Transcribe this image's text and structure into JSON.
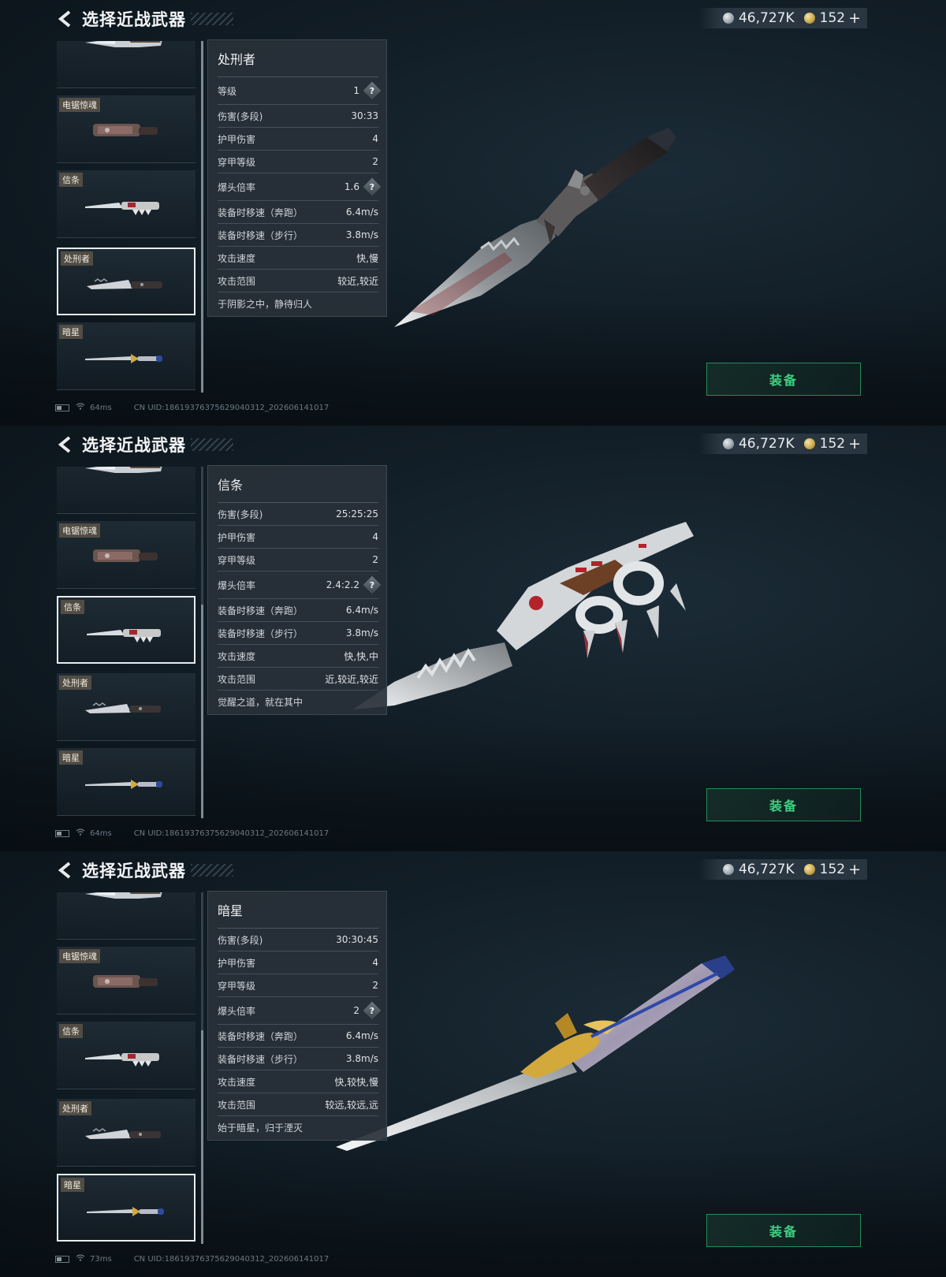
{
  "screens": [
    {
      "header": {
        "title": "选择近战武器"
      },
      "currency": {
        "silver": "46,727K",
        "gold": "152",
        "plus": "+"
      },
      "list": {
        "cards": [
          {
            "label": ""
          },
          {
            "label": "电锯惊魂"
          },
          {
            "label": "信条"
          },
          {
            "label": "处刑者"
          },
          {
            "label": "暗星"
          }
        ],
        "selected_index": 3
      },
      "panel": {
        "title": "处刑者",
        "rows": [
          {
            "label": "等级",
            "value": "1",
            "help": true
          },
          {
            "label": "伤害(多段)",
            "value": "30:33",
            "help": false
          },
          {
            "label": "护甲伤害",
            "value": "4",
            "help": false
          },
          {
            "label": "穿甲等级",
            "value": "2",
            "help": false
          },
          {
            "label": "爆头倍率",
            "value": "1.6",
            "help": true
          },
          {
            "label": "装备时移速（奔跑）",
            "value": "6.4m/s",
            "help": false
          },
          {
            "label": "装备时移速（步行）",
            "value": "3.8m/s",
            "help": false
          },
          {
            "label": "攻击速度",
            "value": "快,慢",
            "help": false
          },
          {
            "label": "攻击范围",
            "value": "较近,较近",
            "help": false
          }
        ],
        "description": "于阴影之中，静待归人"
      },
      "equip_label": "装备",
      "status": {
        "ping": "64ms",
        "uid": "CN UID:1861937637562904031​2_202606141017"
      }
    },
    {
      "header": {
        "title": "选择近战武器"
      },
      "currency": {
        "silver": "46,727K",
        "gold": "152",
        "plus": "+"
      },
      "list": {
        "cards": [
          {
            "label": ""
          },
          {
            "label": "电锯惊魂"
          },
          {
            "label": "信条"
          },
          {
            "label": "处刑者"
          },
          {
            "label": "暗星"
          }
        ],
        "selected_index": 2
      },
      "panel": {
        "title": "信条",
        "rows": [
          {
            "label": "伤害(多段)",
            "value": "25:25:25",
            "help": false
          },
          {
            "label": "护甲伤害",
            "value": "4",
            "help": false
          },
          {
            "label": "穿甲等级",
            "value": "2",
            "help": false
          },
          {
            "label": "爆头倍率",
            "value": "2.4:2.2",
            "help": true
          },
          {
            "label": "装备时移速（奔跑）",
            "value": "6.4m/s",
            "help": false
          },
          {
            "label": "装备时移速（步行）",
            "value": "3.8m/s",
            "help": false
          },
          {
            "label": "攻击速度",
            "value": "快,快,中",
            "help": false
          },
          {
            "label": "攻击范围",
            "value": "近,较近,较近",
            "help": false
          }
        ],
        "description": "觉醒之道，就在其中"
      },
      "equip_label": "装备",
      "status": {
        "ping": "64ms",
        "uid": "CN UID:18619376375629040312_202606141017"
      }
    },
    {
      "header": {
        "title": "选择近战武器"
      },
      "currency": {
        "silver": "46,727K",
        "gold": "152",
        "plus": "+"
      },
      "list": {
        "cards": [
          {
            "label": ""
          },
          {
            "label": "电锯惊魂"
          },
          {
            "label": "信条"
          },
          {
            "label": "处刑者"
          },
          {
            "label": "暗星"
          }
        ],
        "selected_index": 4
      },
      "panel": {
        "title": "暗星",
        "rows": [
          {
            "label": "伤害(多段)",
            "value": "30:30:45",
            "help": false
          },
          {
            "label": "护甲伤害",
            "value": "4",
            "help": false
          },
          {
            "label": "穿甲等级",
            "value": "2",
            "help": false
          },
          {
            "label": "爆头倍率",
            "value": "2",
            "help": true
          },
          {
            "label": "装备时移速（奔跑）",
            "value": "6.4m/s",
            "help": false
          },
          {
            "label": "装备时移速（步行）",
            "value": "3.8m/s",
            "help": false
          },
          {
            "label": "攻击速度",
            "value": "快,较快,慢",
            "help": false
          },
          {
            "label": "攻击范围",
            "value": "较远,较远,远",
            "help": false
          }
        ],
        "description": "始于暗星，归于湮灭"
      },
      "equip_label": "装备",
      "status": {
        "ping": "73ms",
        "uid": "CN UID:18619376375629040312_202606141017"
      }
    }
  ]
}
